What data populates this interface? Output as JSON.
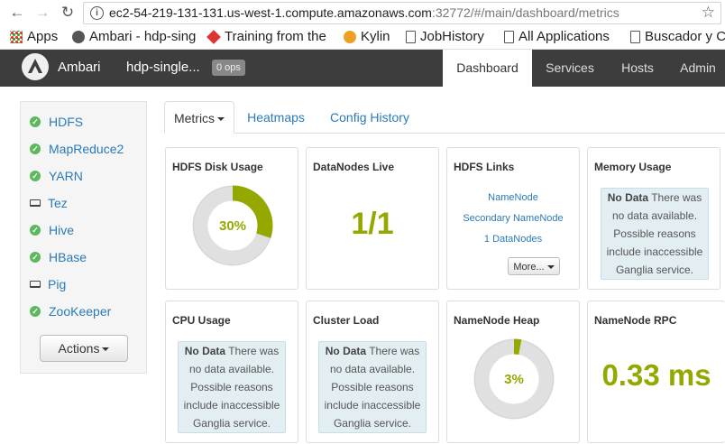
{
  "browser": {
    "url_host": "ec2-54-219-131-131.us-west-1.compute.amazonaws.com",
    "url_path": ":32772/#/main/dashboard/metrics",
    "info_icon": "info-icon",
    "bookmarks": [
      {
        "label": "Apps",
        "icon": "apps-grid-icon"
      },
      {
        "label": "Ambari - hdp-sing",
        "icon": "ambari-icon"
      },
      {
        "label": "Training from the",
        "icon": "training-icon"
      },
      {
        "label": "Kylin",
        "icon": "kylin-icon"
      },
      {
        "label": "JobHistory",
        "icon": "page-icon"
      },
      {
        "label": "All Applications",
        "icon": "page-icon"
      },
      {
        "label": "Buscador y C",
        "icon": "page-icon"
      }
    ]
  },
  "app": {
    "brand": "Ambari",
    "cluster_name": "hdp-single...",
    "ops_badge": "0 ops",
    "nav": [
      {
        "label": "Dashboard",
        "active": true
      },
      {
        "label": "Services",
        "active": false
      },
      {
        "label": "Hosts",
        "active": false
      },
      {
        "label": "Admin",
        "active": false
      }
    ]
  },
  "sidebar": {
    "services": [
      {
        "label": "HDFS",
        "status": "ok"
      },
      {
        "label": "MapReduce2",
        "status": "ok"
      },
      {
        "label": "YARN",
        "status": "ok"
      },
      {
        "label": "Tez",
        "status": "client"
      },
      {
        "label": "Hive",
        "status": "ok"
      },
      {
        "label": "HBase",
        "status": "ok"
      },
      {
        "label": "Pig",
        "status": "client"
      },
      {
        "label": "ZooKeeper",
        "status": "ok"
      }
    ],
    "actions_label": "Actions"
  },
  "tabs": [
    {
      "label": "Metrics",
      "active": true
    },
    {
      "label": "Heatmaps",
      "active": false
    },
    {
      "label": "Config History",
      "active": false
    }
  ],
  "widgets": {
    "hdfs_disk": {
      "title": "HDFS Disk Usage",
      "value_label": "30%",
      "fraction": 0.3
    },
    "datanodes_live": {
      "title": "DataNodes Live",
      "value": "1/1"
    },
    "hdfs_links": {
      "title": "HDFS Links",
      "links": [
        "NameNode",
        "Secondary NameNode",
        "1 DataNodes"
      ],
      "more_label": "More..."
    },
    "memory_usage": {
      "title": "Memory Usage",
      "no_data_bold": "No Data",
      "no_data_text": " There was no data available. Possible reasons include inaccessible Ganglia service."
    },
    "cpu_usage": {
      "title": "CPU Usage",
      "no_data_bold": "No Data",
      "no_data_text": " There was no data available. Possible reasons include inaccessible Ganglia service."
    },
    "cluster_load": {
      "title": "Cluster Load",
      "no_data_bold": "No Data",
      "no_data_text": " There was no data available. Possible reasons include inaccessible Ganglia service."
    },
    "namenode_heap": {
      "title": "NameNode Heap",
      "value_label": "3%",
      "fraction": 0.03
    },
    "namenode_rpc": {
      "title": "NameNode RPC",
      "value": "0.33 ms"
    }
  },
  "colors": {
    "accent_green": "#95a800",
    "link_blue": "#2a7ab8",
    "nav_dark": "#3d3d3d",
    "status_ok": "#5cb85c"
  }
}
